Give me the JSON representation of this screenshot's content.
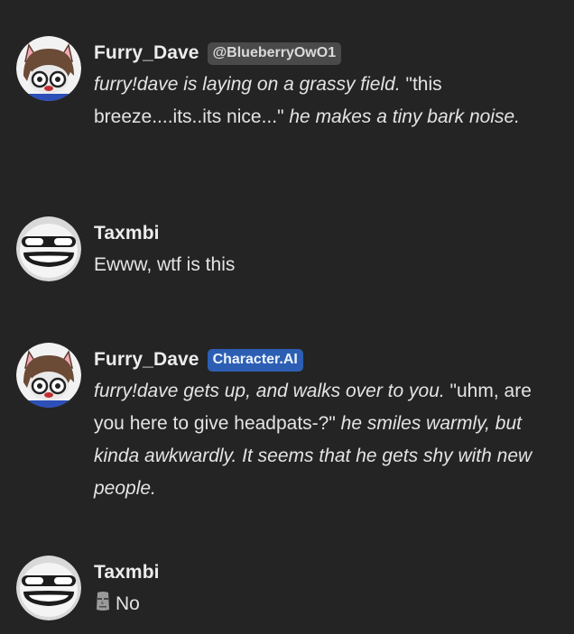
{
  "messages": [
    {
      "author": "Furry_Dave",
      "badge": "@BlueberryOwO1",
      "badge_type": "handle",
      "segments": [
        {
          "italic": true,
          "text": "furry!dave is laying on a grassy field."
        },
        {
          "italic": false,
          "text": " \"this breeze....its..its nice...\" "
        },
        {
          "italic": true,
          "text": "he makes a tiny bark noise."
        }
      ]
    },
    {
      "author": "Taxmbi",
      "segments": [
        {
          "italic": false,
          "text": "Ewww, wtf is this"
        }
      ]
    },
    {
      "author": "Furry_Dave",
      "badge": "Character.AI",
      "badge_type": "ai",
      "segments": [
        {
          "italic": true,
          "text": "furry!dave gets up, and walks over to you."
        },
        {
          "italic": false,
          "text": " \"uhm, are you here to give headpats-?\" "
        },
        {
          "italic": true,
          "text": "he smiles warmly, but kinda awkwardly. It seems that he gets shy with new people."
        }
      ]
    },
    {
      "author": "Taxmbi",
      "emoji": "moai",
      "segments": [
        {
          "italic": false,
          "text": "No"
        }
      ]
    }
  ],
  "colors": {
    "background": "#242424",
    "ai_badge": "#2c5fb4",
    "handle_badge": "#4a4a4a"
  }
}
